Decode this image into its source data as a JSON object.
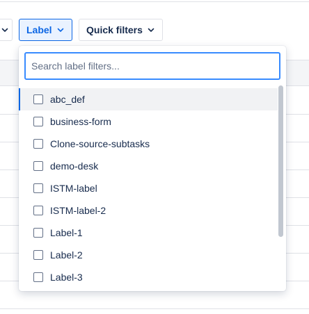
{
  "filter_bar": {
    "label_button": "Label",
    "quick_filters_button": "Quick filters"
  },
  "dropdown": {
    "search_placeholder": "Search label filters...",
    "search_value": "",
    "items": [
      {
        "label": "abc_def",
        "checked": false
      },
      {
        "label": "business-form",
        "checked": false
      },
      {
        "label": "Clone-source-subtasks",
        "checked": false
      },
      {
        "label": "demo-desk",
        "checked": false
      },
      {
        "label": "ISTM-label",
        "checked": false
      },
      {
        "label": "ISTM-label-2",
        "checked": false
      },
      {
        "label": "Label-1",
        "checked": false
      },
      {
        "label": "Label-2",
        "checked": false
      },
      {
        "label": "Label-3",
        "checked": false
      }
    ]
  },
  "colors": {
    "accent": "#0c66e4",
    "focus_border": "#388bff",
    "selected_bg": "#e9f2ff",
    "hover_bg": "#f1f2f4",
    "text": "#172b4d"
  },
  "icons": {
    "dropdown_chevron": "chevron-down-icon"
  }
}
